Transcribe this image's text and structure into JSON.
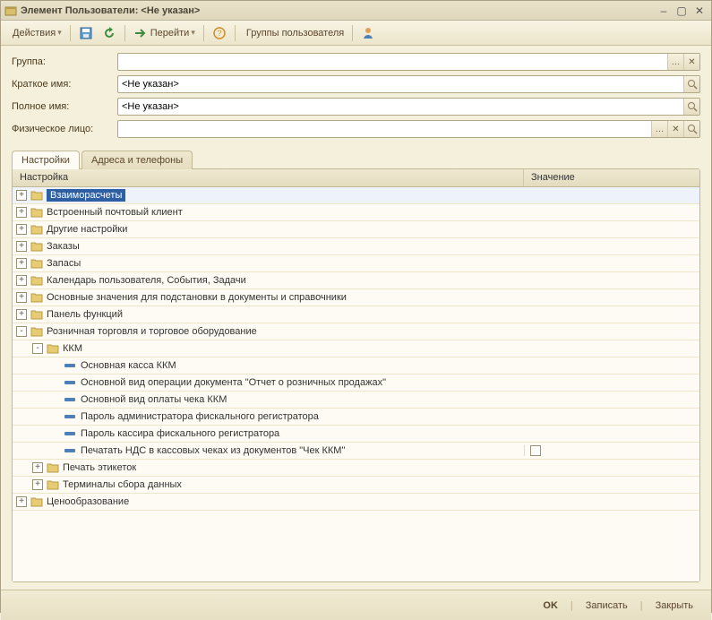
{
  "titlebar": {
    "title": "Элемент Пользователи: <Не указан>"
  },
  "toolbar": {
    "actions_label": "Действия",
    "goto_label": "Перейти",
    "groups_label": "Группы пользователя"
  },
  "form": {
    "group_label": "Группа:",
    "group_value": "",
    "shortname_label": "Краткое имя:",
    "shortname_value": "<Не указан>",
    "fullname_label": "Полное имя:",
    "fullname_value": "<Не указан>",
    "person_label": "Физическое лицо:",
    "person_value": ""
  },
  "tabs": {
    "settings_label": "Настройки",
    "addresses_label": "Адреса и телефоны"
  },
  "grid": {
    "col_name": "Настройка",
    "col_value": "Значение"
  },
  "tree": [
    {
      "level": 0,
      "exp": "+",
      "type": "folder",
      "label": "Взаиморасчеты",
      "selected": true
    },
    {
      "level": 0,
      "exp": "+",
      "type": "folder",
      "label": "Встроенный почтовый клиент"
    },
    {
      "level": 0,
      "exp": "+",
      "type": "folder",
      "label": "Другие настройки"
    },
    {
      "level": 0,
      "exp": "+",
      "type": "folder",
      "label": "Заказы"
    },
    {
      "level": 0,
      "exp": "+",
      "type": "folder",
      "label": "Запасы"
    },
    {
      "level": 0,
      "exp": "+",
      "type": "folder",
      "label": "Календарь пользователя, События, Задачи"
    },
    {
      "level": 0,
      "exp": "+",
      "type": "folder",
      "label": "Основные значения для подстановки в документы и справочники"
    },
    {
      "level": 0,
      "exp": "+",
      "type": "folder",
      "label": "Панель функций"
    },
    {
      "level": 0,
      "exp": "-",
      "type": "folder",
      "label": "Розничная торговля и торговое оборудование"
    },
    {
      "level": 1,
      "exp": "-",
      "type": "folder",
      "label": "ККМ"
    },
    {
      "level": 2,
      "exp": "",
      "type": "leaf",
      "label": "Основная касса ККМ"
    },
    {
      "level": 2,
      "exp": "",
      "type": "leaf",
      "label": "Основной вид операции документа \"Отчет о розничных продажах\""
    },
    {
      "level": 2,
      "exp": "",
      "type": "leaf",
      "label": "Основной вид оплаты чека ККМ"
    },
    {
      "level": 2,
      "exp": "",
      "type": "leaf",
      "label": "Пароль администратора фискального регистратора"
    },
    {
      "level": 2,
      "exp": "",
      "type": "leaf",
      "label": "Пароль кассира фискального регистратора"
    },
    {
      "level": 2,
      "exp": "",
      "type": "leaf",
      "label": "Печатать НДС в кассовых чеках из документов \"Чек ККМ\"",
      "value_type": "checkbox",
      "value_checked": false
    },
    {
      "level": 1,
      "exp": "+",
      "type": "folder",
      "label": "Печать этикеток"
    },
    {
      "level": 1,
      "exp": "+",
      "type": "folder",
      "label": "Терминалы сбора данных"
    },
    {
      "level": 0,
      "exp": "+",
      "type": "folder",
      "label": "Ценообразование"
    }
  ],
  "footer": {
    "ok_label": "OK",
    "save_label": "Записать",
    "close_label": "Закрыть"
  }
}
